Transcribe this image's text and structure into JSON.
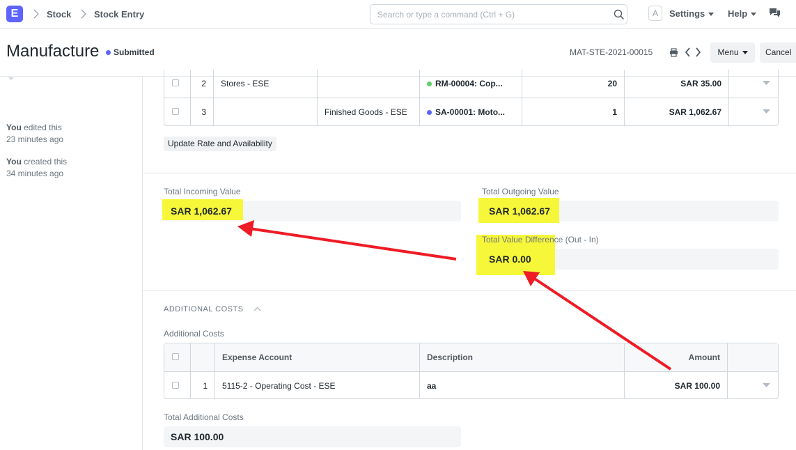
{
  "navbar": {
    "logo_letter": "E",
    "breadcrumbs": [
      "Stock",
      "Stock Entry"
    ],
    "search_placeholder": "Search or type a command (Ctrl + G)",
    "avatar_letter": "A",
    "settings_label": "Settings",
    "help_label": "Help"
  },
  "page": {
    "title": "Manufacture",
    "status": "Submitted",
    "doc_name": "MAT-STE-2021-00015",
    "menu_label": "Menu",
    "cancel_label": "Cancel",
    "status_color": "#5e64ff"
  },
  "sidebar": {
    "timeline": [
      {
        "who": "You",
        "action": "edited this",
        "when": "23 minutes ago"
      },
      {
        "who": "You",
        "action": "created this",
        "when": "34 minutes ago"
      }
    ]
  },
  "items": {
    "rows": [
      {
        "idx": "2",
        "source_warehouse": "Stores - ESE",
        "target_warehouse": "",
        "item": "RM-00004: Cop...",
        "item_dot_color": "#5fd068",
        "qty": "20",
        "rate": "SAR 35.00"
      },
      {
        "idx": "3",
        "source_warehouse": "",
        "target_warehouse": "Finished Goods - ESE",
        "item": "SA-00001: Moto...",
        "item_dot_color": "#5e64ff",
        "qty": "1",
        "rate": "SAR 1,062.67"
      }
    ],
    "update_button": "Update Rate and Availability"
  },
  "totals": {
    "incoming_label": "Total Incoming Value",
    "incoming_value": "SAR 1,062.67",
    "outgoing_label": "Total Outgoing Value",
    "outgoing_value": "SAR 1,062.67",
    "difference_label": "Total Value Difference (Out - In)",
    "difference_value": "SAR 0.00"
  },
  "additional_costs": {
    "section_title": "ADDITIONAL COSTS",
    "table_label": "Additional Costs",
    "headers": {
      "expense_account": "Expense Account",
      "description": "Description",
      "amount": "Amount"
    },
    "rows": [
      {
        "idx": "1",
        "expense_account": "5115-2 - Operating Cost - ESE",
        "description": "aa",
        "amount": "SAR 100.00"
      }
    ],
    "total_label": "Total Additional Costs",
    "total_value": "SAR 100.00"
  },
  "annotation": {
    "highlight_color": "#f7f73a",
    "arrow_color": "#ee1c25"
  }
}
